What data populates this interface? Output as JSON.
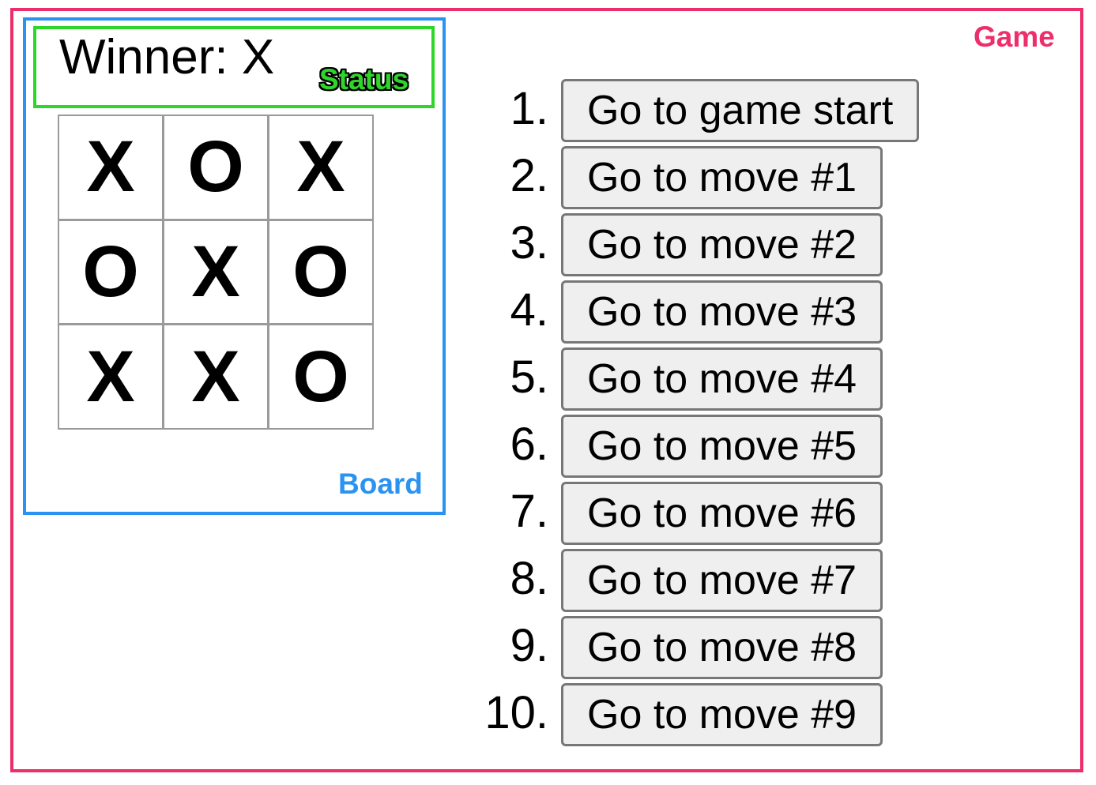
{
  "labels": {
    "game": "Game",
    "board": "Board",
    "status": "Status"
  },
  "status_text": "Winner: X",
  "squares": [
    "X",
    "O",
    "X",
    "O",
    "X",
    "O",
    "X",
    "X",
    "O"
  ],
  "moves": [
    {
      "number": "1.",
      "label": "Go to game start"
    },
    {
      "number": "2.",
      "label": "Go to move #1"
    },
    {
      "number": "3.",
      "label": "Go to move #2"
    },
    {
      "number": "4.",
      "label": "Go to move #3"
    },
    {
      "number": "5.",
      "label": "Go to move #4"
    },
    {
      "number": "6.",
      "label": "Go to move #5"
    },
    {
      "number": "7.",
      "label": "Go to move #6"
    },
    {
      "number": "8.",
      "label": "Go to move #7"
    },
    {
      "number": "9.",
      "label": "Go to move #8"
    },
    {
      "number": "10.",
      "label": "Go to move #9"
    }
  ],
  "colors": {
    "game": "#ee2e6a",
    "board": "#2a93f2",
    "status": "#2ed62a"
  }
}
